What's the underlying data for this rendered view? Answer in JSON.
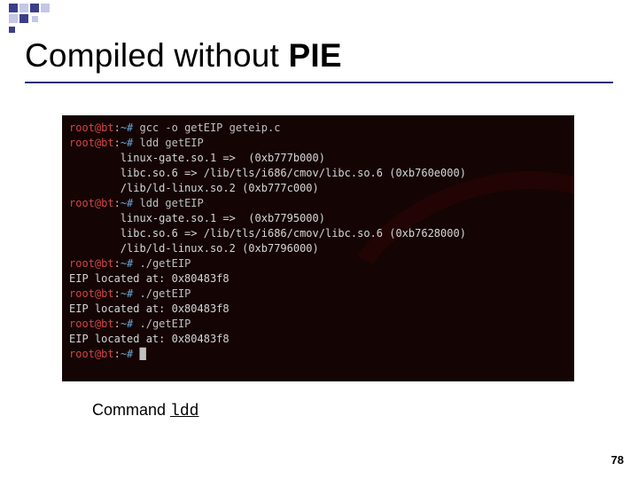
{
  "title_plain": "Compiled without ",
  "title_bold": "PIE",
  "caption_label": "Command ",
  "caption_cmd": "ldd",
  "page_number": "78",
  "term": {
    "prompt_user": "root@bt",
    "prompt_sep": ":",
    "prompt_path": "~#",
    "cursor": "█",
    "lines": [
      {
        "type": "cmd",
        "text": " gcc -o getEIP geteip.c"
      },
      {
        "type": "cmd",
        "text": " ldd getEIP"
      },
      {
        "type": "out",
        "text": "        linux-gate.so.1 =>  (0xb777b000)"
      },
      {
        "type": "out",
        "text": "        libc.so.6 => /lib/tls/i686/cmov/libc.so.6 (0xb760e000)"
      },
      {
        "type": "out",
        "text": "        /lib/ld-linux.so.2 (0xb777c000)"
      },
      {
        "type": "cmd",
        "text": " ldd getEIP"
      },
      {
        "type": "out",
        "text": "        linux-gate.so.1 =>  (0xb7795000)"
      },
      {
        "type": "out",
        "text": "        libc.so.6 => /lib/tls/i686/cmov/libc.so.6 (0xb7628000)"
      },
      {
        "type": "out",
        "text": "        /lib/ld-linux.so.2 (0xb7796000)"
      },
      {
        "type": "cmd",
        "text": " ./getEIP"
      },
      {
        "type": "out",
        "text": "EIP located at: 0x80483f8"
      },
      {
        "type": "cmd",
        "text": " ./getEIP"
      },
      {
        "type": "out",
        "text": "EIP located at: 0x80483f8"
      },
      {
        "type": "cmd",
        "text": " ./getEIP"
      },
      {
        "type": "out",
        "text": "EIP located at: 0x80483f8"
      },
      {
        "type": "cmd",
        "text": ""
      }
    ]
  }
}
